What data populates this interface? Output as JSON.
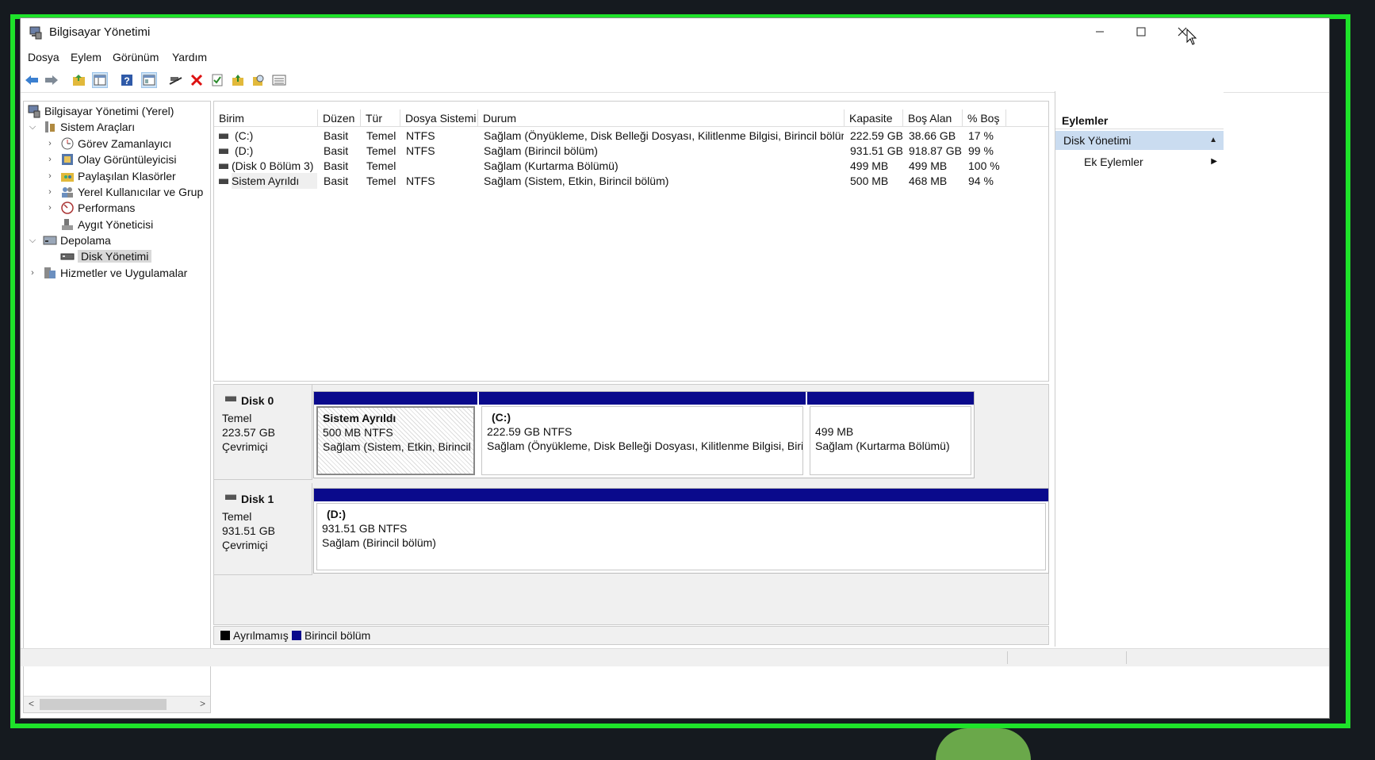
{
  "window": {
    "title": "Bilgisayar Yönetimi",
    "controls": [
      "minimize",
      "maximize",
      "close"
    ]
  },
  "menu": [
    "Dosya",
    "Eylem",
    "Görünüm",
    "Yardım"
  ],
  "toolbar_icons": [
    "back-arrow-icon",
    "forward-arrow-icon",
    "up-folder-icon",
    "show-hide-tree-icon",
    "help-icon",
    "console-view-icon",
    "connect-icon",
    "delete-icon",
    "properties-icon",
    "folder-up-icon",
    "search-icon",
    "list-view-icon"
  ],
  "tree": {
    "items": [
      {
        "label": "Bilgisayar Yönetimi (Yerel)",
        "level": 0,
        "expander": ""
      },
      {
        "label": "Sistem Araçları",
        "level": 1,
        "expander": "open"
      },
      {
        "label": "Görev Zamanlayıcı",
        "level": 2,
        "expander": "closed"
      },
      {
        "label": "Olay Görüntüleyicisi",
        "level": 2,
        "expander": "closed"
      },
      {
        "label": "Paylaşılan Klasörler",
        "level": 2,
        "expander": "closed"
      },
      {
        "label": "Yerel Kullanıcılar ve Grup",
        "level": 2,
        "expander": "closed"
      },
      {
        "label": "Performans",
        "level": 2,
        "expander": "closed"
      },
      {
        "label": "Aygıt Yöneticisi",
        "level": 2,
        "expander": ""
      },
      {
        "label": "Depolama",
        "level": 1,
        "expander": "open"
      },
      {
        "label": "Disk Yönetimi",
        "level": 2,
        "expander": "",
        "selected": true
      },
      {
        "label": "Hizmetler ve Uygulamalar",
        "level": 1,
        "expander": "closed"
      }
    ]
  },
  "volume_list": {
    "columns": [
      "Birim",
      "Düzen",
      "Tür",
      "Dosya Sistemi",
      "Durum",
      "Kapasite",
      "Boş Alan",
      "% Boş"
    ],
    "rows": [
      [
        "(C:)",
        "Basit",
        "Temel",
        "NTFS",
        "Sağlam (Önyükleme, Disk Belleği Dosyası, Kilitlenme Bilgisi, Birincil bölüm)",
        "222.59 GB",
        "38.66 GB",
        "17 %"
      ],
      [
        "(D:)",
        "Basit",
        "Temel",
        "NTFS",
        "Sağlam (Birincil bölüm)",
        "931.51 GB",
        "918.87 GB",
        "99 %"
      ],
      [
        "(Disk 0 Bölüm 3)",
        "Basit",
        "Temel",
        "",
        "Sağlam (Kurtarma Bölümü)",
        "499 MB",
        "499 MB",
        "100 %"
      ],
      [
        "Sistem Ayrıldı",
        "Basit",
        "Temel",
        "NTFS",
        "Sağlam (Sistem, Etkin, Birincil bölüm)",
        "500 MB",
        "468 MB",
        "94 %"
      ]
    ]
  },
  "disks": [
    {
      "name": "Disk 0",
      "type": "Temel",
      "size": "223.57 GB",
      "state": "Çevrimiçi",
      "partitions": [
        {
          "title": "Sistem Ayrıldı",
          "size": "500 MB NTFS",
          "status": "Sağlam (Sistem, Etkin, Birincil bölüm)"
        },
        {
          "title": "(C:)",
          "size": "222.59 GB NTFS",
          "status": "Sağlam (Önyükleme, Disk Belleği Dosyası, Kilitlenme Bilgisi, Birincil bölüm)"
        },
        {
          "title": "",
          "size": "499 MB",
          "status": "Sağlam (Kurtarma Bölümü)"
        }
      ]
    },
    {
      "name": "Disk 1",
      "type": "Temel",
      "size": "931.51 GB",
      "state": "Çevrimiçi",
      "partitions": [
        {
          "title": "(D:)",
          "size": "931.51 GB NTFS",
          "status": "Sağlam (Birincil bölüm)"
        }
      ]
    }
  ],
  "legend": [
    {
      "label": "Ayrılmamış",
      "color": "#000000"
    },
    {
      "label": "Birincil bölüm",
      "color": "#0a0a8c"
    }
  ],
  "actions": {
    "header": "Eylemler",
    "selected": "Disk Yönetimi",
    "more": "Ek Eylemler"
  },
  "colors": {
    "frame": "#1ee32a",
    "partition_bar": "#0a0a8c",
    "action_selected": "#cadcf0"
  }
}
